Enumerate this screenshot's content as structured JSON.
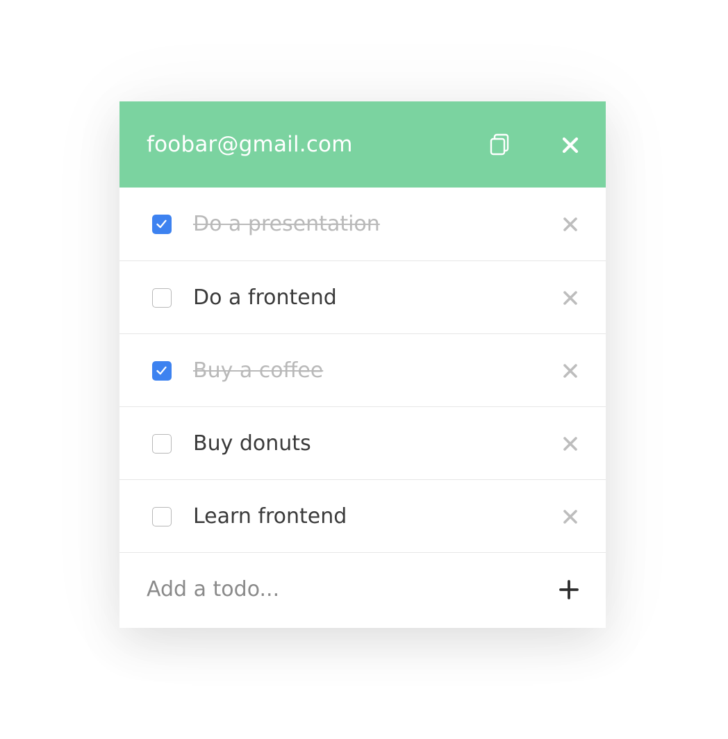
{
  "header": {
    "email": "foobar@gmail.com",
    "copy_icon": "copy-icon",
    "close_icon": "close-icon",
    "background_color": "#7bd3a0"
  },
  "todos": [
    {
      "text": "Do a presentation",
      "done": true
    },
    {
      "text": "Do a frontend",
      "done": false
    },
    {
      "text": "Buy a coffee",
      "done": true
    },
    {
      "text": "Buy donuts",
      "done": false
    },
    {
      "text": "Learn frontend",
      "done": false
    }
  ],
  "add": {
    "placeholder": "Add a todo...",
    "value": "",
    "icon": "plus-icon"
  },
  "colors": {
    "accent": "#7bd3a0",
    "checkbox_checked": "#3d82f0",
    "done_text": "#b9b9b9",
    "text": "#3a3a3a",
    "delete_icon": "#bdbdbd"
  }
}
